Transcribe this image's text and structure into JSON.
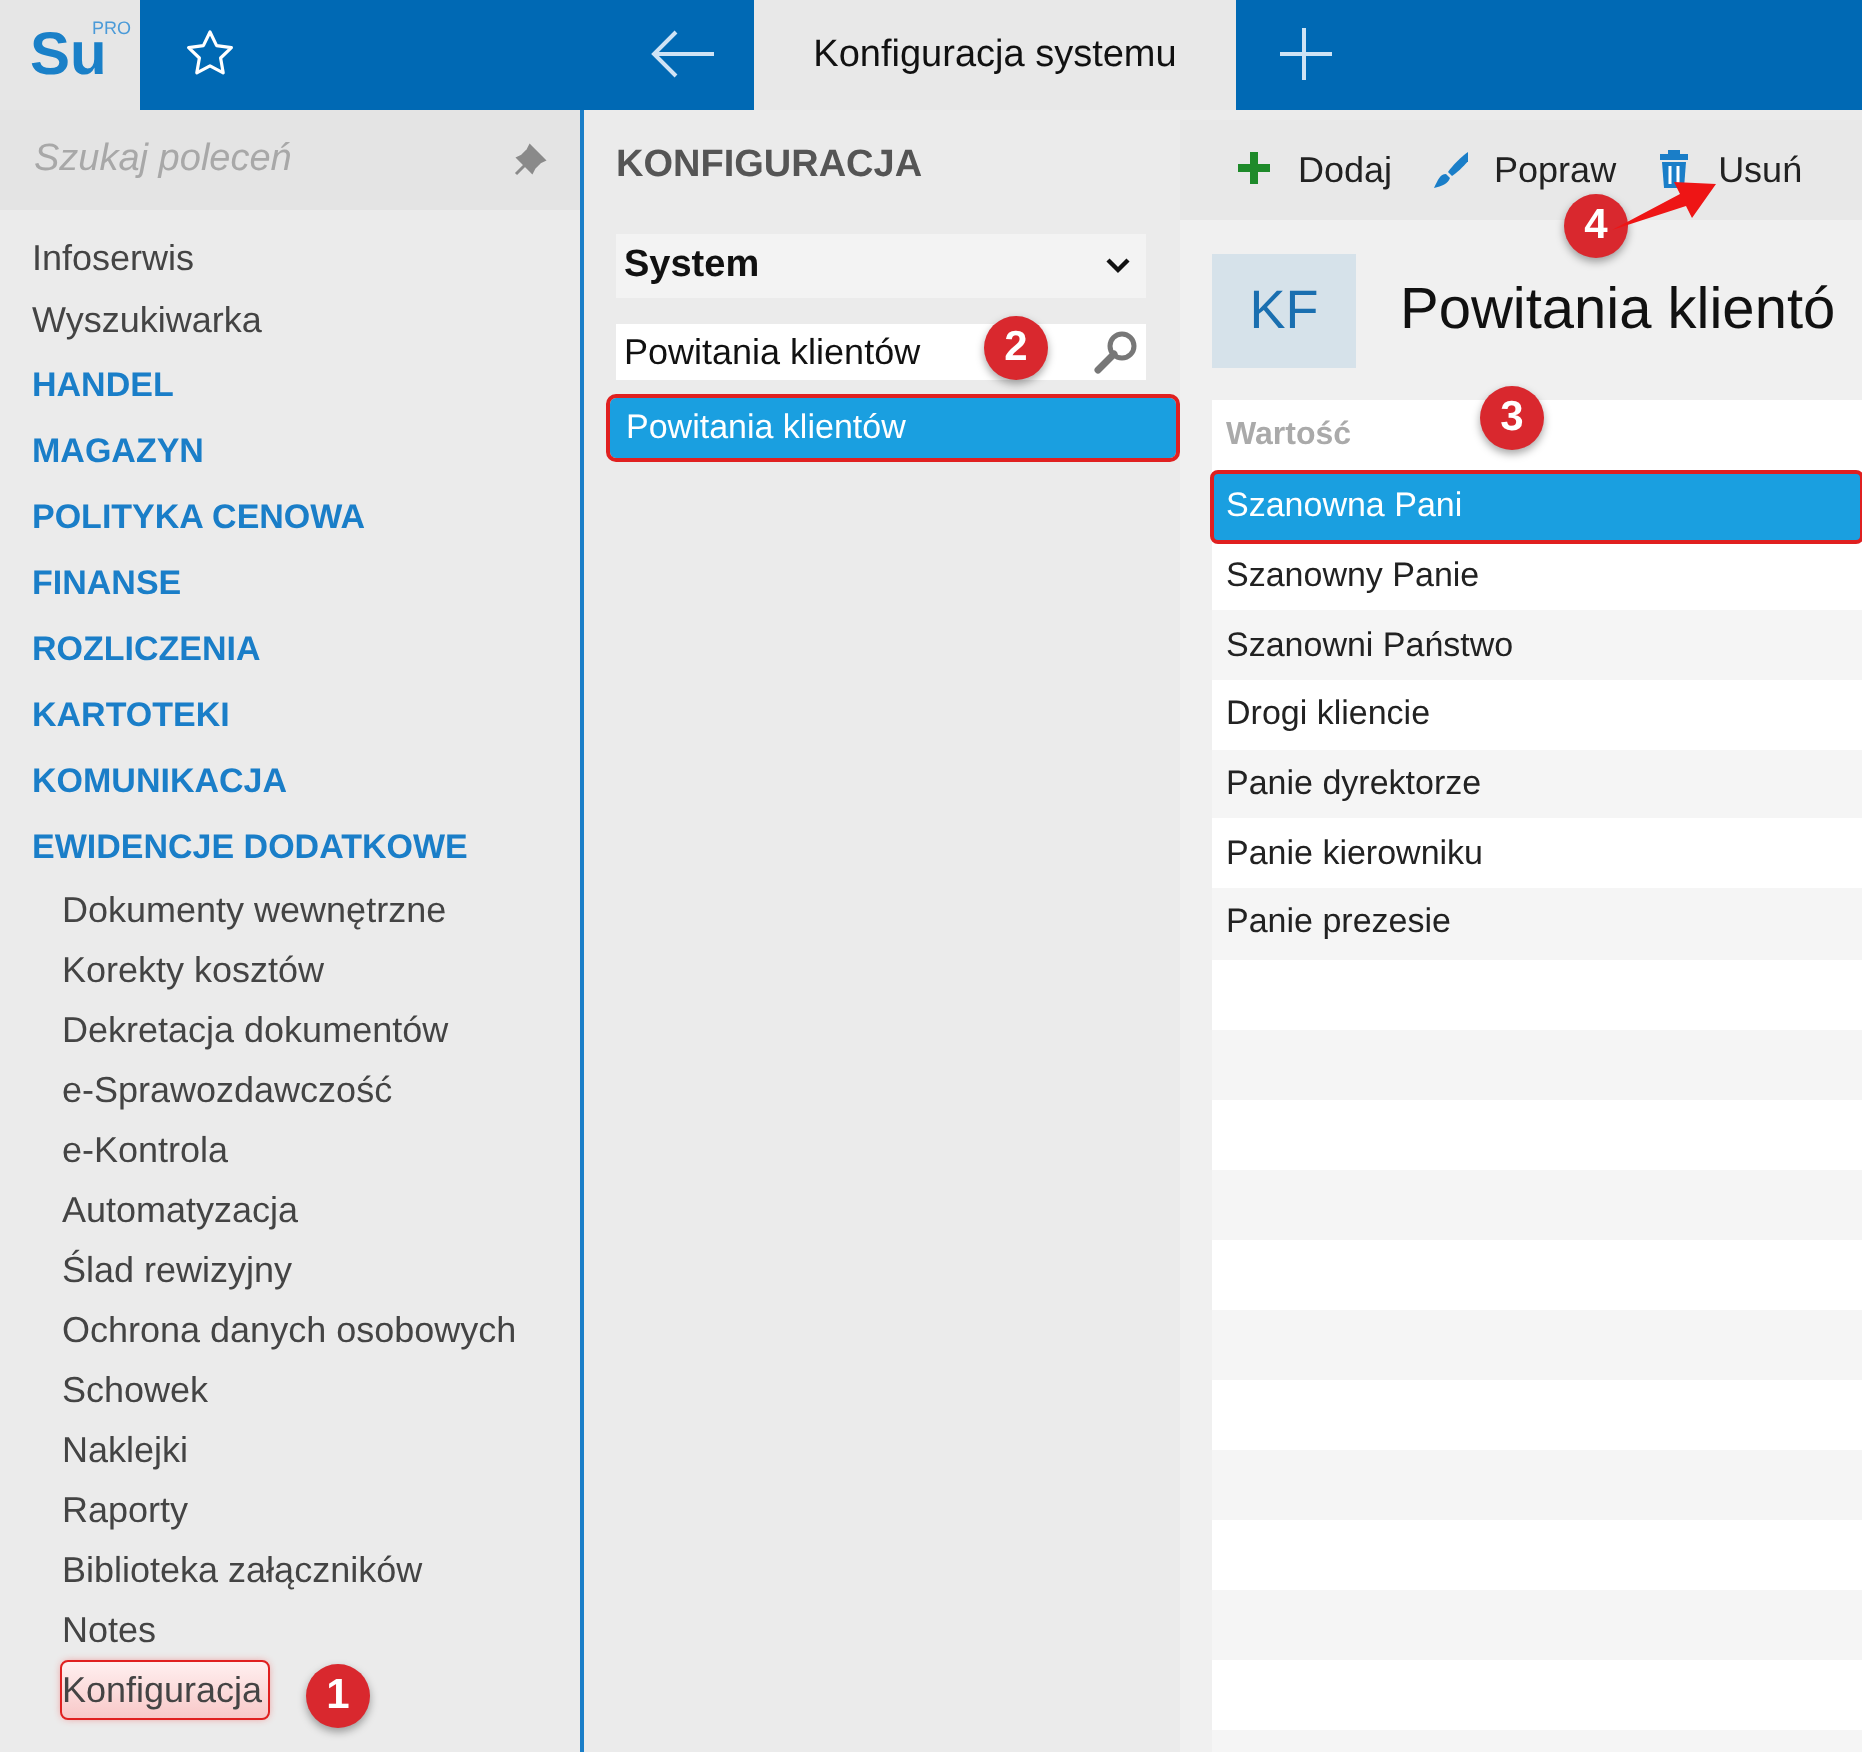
{
  "topbar": {
    "logo": {
      "text": "Su",
      "badge": "PRO"
    },
    "tab": {
      "label": "Konfiguracja systemu",
      "selected": true
    }
  },
  "sidebar": {
    "search": {
      "placeholder": "Szukaj poleceń"
    },
    "items": [
      {
        "kind": "link",
        "label": "Infoserwis",
        "highlighted": false
      },
      {
        "kind": "link",
        "label": "Wyszukiwarka",
        "highlighted": false
      },
      {
        "kind": "section",
        "label": "HANDEL",
        "highlighted": false
      },
      {
        "kind": "section",
        "label": "MAGAZYN",
        "highlighted": false
      },
      {
        "kind": "section",
        "label": "POLITYKA CENOWA",
        "highlighted": false
      },
      {
        "kind": "section",
        "label": "FINANSE",
        "highlighted": false
      },
      {
        "kind": "section",
        "label": "ROZLICZENIA",
        "highlighted": false
      },
      {
        "kind": "section",
        "label": "KARTOTEKI",
        "highlighted": false
      },
      {
        "kind": "section",
        "label": "KOMUNIKACJA",
        "highlighted": false
      },
      {
        "kind": "section",
        "label": "EWIDENCJE DODATKOWE",
        "highlighted": false
      },
      {
        "kind": "sub",
        "label": "Dokumenty wewnętrzne",
        "highlighted": false
      },
      {
        "kind": "sub",
        "label": "Korekty kosztów",
        "highlighted": false
      },
      {
        "kind": "sub",
        "label": "Dekretacja dokumentów",
        "highlighted": false
      },
      {
        "kind": "sub",
        "label": "e-Sprawozdawczość",
        "highlighted": false
      },
      {
        "kind": "sub",
        "label": "e-Kontrola",
        "highlighted": false
      },
      {
        "kind": "sub",
        "label": "Automatyzacja",
        "highlighted": false
      },
      {
        "kind": "sub",
        "label": "Ślad rewizyjny",
        "highlighted": false
      },
      {
        "kind": "sub",
        "label": "Ochrona danych osobowych",
        "highlighted": false
      },
      {
        "kind": "sub",
        "label": "Schowek",
        "highlighted": false
      },
      {
        "kind": "sub",
        "label": "Naklejki",
        "highlighted": false
      },
      {
        "kind": "sub",
        "label": "Raporty",
        "highlighted": false
      },
      {
        "kind": "sub",
        "label": "Biblioteka załączników",
        "highlighted": false
      },
      {
        "kind": "sub",
        "label": "Notes",
        "highlighted": false
      },
      {
        "kind": "sub",
        "label": "Konfiguracja",
        "highlighted": true
      }
    ]
  },
  "config": {
    "title": "KONFIGURACJA",
    "dropdown": {
      "value": "System"
    },
    "search": {
      "value": "Powitania klientów"
    },
    "items": [
      {
        "label": "Powitania klientów",
        "selected": true,
        "highlighted": true
      }
    ]
  },
  "toolbar": [
    {
      "kind": "add",
      "label": "Dodaj"
    },
    {
      "kind": "edit",
      "label": "Popraw"
    },
    {
      "kind": "delete",
      "label": "Usuń"
    }
  ],
  "detail": {
    "badge": "KF",
    "title": "Powitania klientó",
    "table": {
      "columns": [
        "Wartość"
      ],
      "rows": [
        {
          "value": "Szanowna Pani",
          "selected": true,
          "highlighted": true
        },
        {
          "value": "Szanowny Panie",
          "selected": false,
          "highlighted": false
        },
        {
          "value": "Szanowni Państwo",
          "selected": false,
          "highlighted": false
        },
        {
          "value": "Drogi kliencie",
          "selected": false,
          "highlighted": false
        },
        {
          "value": "Panie dyrektorze",
          "selected": false,
          "highlighted": false
        },
        {
          "value": "Panie kierowniku",
          "selected": false,
          "highlighted": false
        },
        {
          "value": "Panie prezesie",
          "selected": false,
          "highlighted": false
        }
      ]
    }
  },
  "callouts": [
    {
      "number": "1"
    },
    {
      "number": "2"
    },
    {
      "number": "3"
    },
    {
      "number": "4",
      "arrow": true
    }
  ]
}
